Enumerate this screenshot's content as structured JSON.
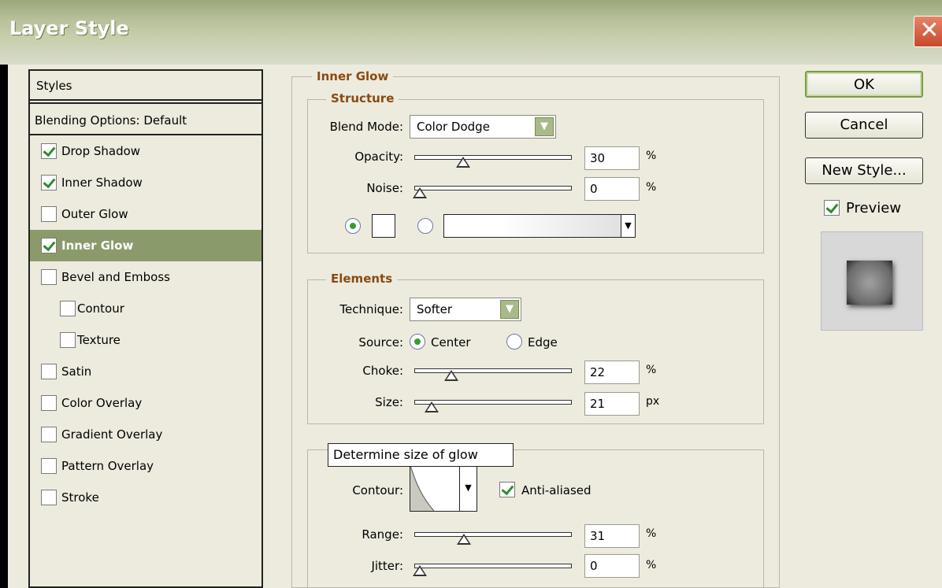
{
  "window": {
    "title": "Layer Style",
    "close_glyph": "✕"
  },
  "styles": {
    "header": "Styles",
    "blending_options": "Blending Options: Default",
    "items": [
      {
        "label": "Drop Shadow",
        "checked": true
      },
      {
        "label": "Inner Shadow",
        "checked": true
      },
      {
        "label": "Outer Glow",
        "checked": false
      },
      {
        "label": "Inner Glow",
        "checked": true,
        "selected": true
      },
      {
        "label": "Bevel and Emboss",
        "checked": false
      },
      {
        "label": "Contour",
        "checked": false
      },
      {
        "label": "Texture",
        "checked": false
      },
      {
        "label": "Satin",
        "checked": false
      },
      {
        "label": "Color Overlay",
        "checked": false
      },
      {
        "label": "Gradient Overlay",
        "checked": false
      },
      {
        "label": "Pattern Overlay",
        "checked": false
      },
      {
        "label": "Stroke",
        "checked": false
      }
    ]
  },
  "inner_glow": {
    "title": "Inner Glow",
    "structure": {
      "title": "Structure",
      "blend_mode_label": "Blend Mode:",
      "blend_mode_value": "Color Dodge",
      "opacity_label": "Opacity:",
      "opacity_value": "30",
      "opacity_unit": "%",
      "opacity_level": 30,
      "noise_label": "Noise:",
      "noise_value": "0",
      "noise_unit": "%",
      "noise_level": 0,
      "color_swatch": "#ffffff",
      "color_mode": "solid"
    },
    "elements": {
      "title": "Elements",
      "technique_label": "Technique:",
      "technique_value": "Softer",
      "source_label": "Source:",
      "source_center": "Center",
      "source_edge": "Edge",
      "source_selected": "Center",
      "choke_label": "Choke:",
      "choke_value": "22",
      "choke_unit": "%",
      "choke_level": 22,
      "size_label": "Size:",
      "size_value": "21",
      "size_unit": "px",
      "size_level": 8
    },
    "quality": {
      "contour_label": "Contour:",
      "anti_aliased_label": "Anti-aliased",
      "anti_aliased": true,
      "range_label": "Range:",
      "range_value": "31",
      "range_unit": "%",
      "range_level": 31,
      "jitter_label": "Jitter:",
      "jitter_value": "0",
      "jitter_unit": "%",
      "jitter_level": 0
    },
    "tooltip": "Determine size of glow"
  },
  "buttons": {
    "ok": "OK",
    "cancel": "Cancel",
    "new_style": "New Style..."
  },
  "preview": {
    "label": "Preview",
    "checked": true
  },
  "colors": {
    "accent": "#8b9a6b",
    "group_title": "#8a4a12",
    "check": "#2f8a2f"
  }
}
